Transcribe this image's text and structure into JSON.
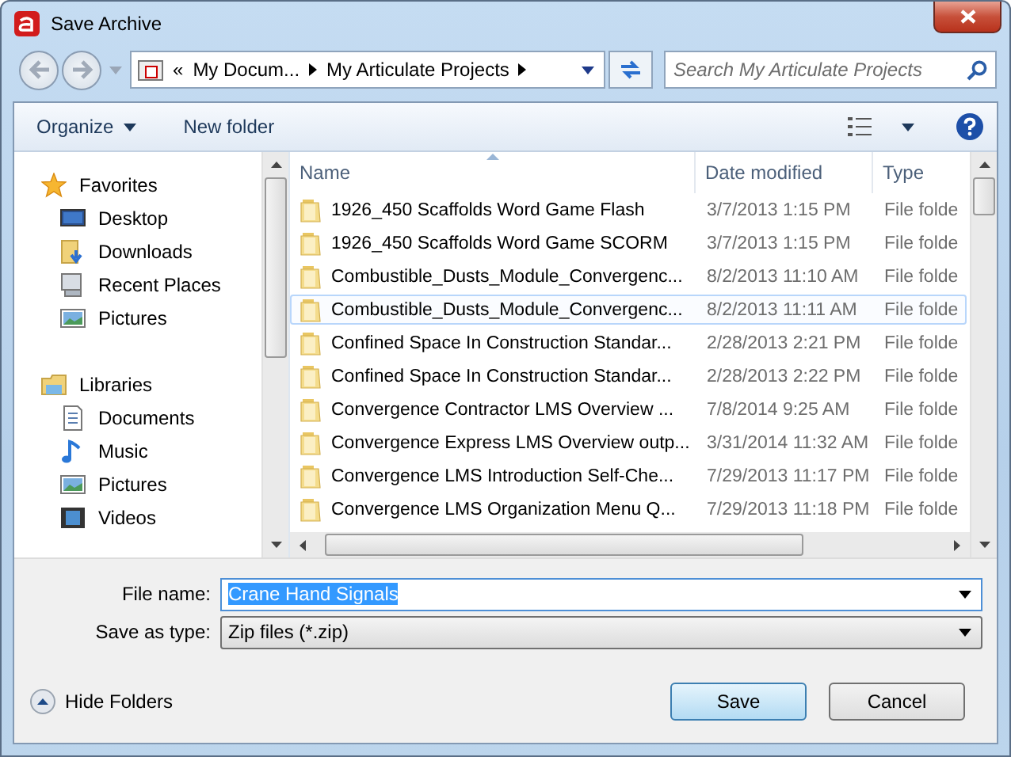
{
  "window": {
    "title": "Save Archive"
  },
  "address": {
    "parts": [
      "«",
      "My Docum...",
      "My Articulate Projects"
    ]
  },
  "search": {
    "placeholder": "Search My Articulate Projects"
  },
  "toolbar": {
    "organize": "Organize",
    "new_folder": "New folder"
  },
  "sidebar": {
    "items": [
      {
        "kind": "group",
        "label": "Favorites"
      },
      {
        "kind": "item",
        "label": "Desktop"
      },
      {
        "kind": "item",
        "label": "Downloads"
      },
      {
        "kind": "item",
        "label": "Recent Places"
      },
      {
        "kind": "item",
        "label": "Pictures"
      },
      {
        "kind": "gap"
      },
      {
        "kind": "group",
        "label": "Libraries"
      },
      {
        "kind": "item",
        "label": "Documents"
      },
      {
        "kind": "item",
        "label": "Music"
      },
      {
        "kind": "item",
        "label": "Pictures"
      },
      {
        "kind": "item",
        "label": "Videos"
      }
    ]
  },
  "table": {
    "columns": [
      "Name",
      "Date modified",
      "Type"
    ],
    "rows": [
      {
        "name": "1926_450 Scaffolds Word Game Flash",
        "date": "3/7/2013 1:15 PM",
        "type": "File folde",
        "selected": false
      },
      {
        "name": "1926_450 Scaffolds Word Game SCORM",
        "date": "3/7/2013 1:15 PM",
        "type": "File folde",
        "selected": false
      },
      {
        "name": "Combustible_Dusts_Module_Convergenc...",
        "date": "8/2/2013 11:10 AM",
        "type": "File folde",
        "selected": false
      },
      {
        "name": "Combustible_Dusts_Module_Convergenc...",
        "date": "8/2/2013 11:11 AM",
        "type": "File folde",
        "selected": true
      },
      {
        "name": "Confined Space In Construction Standar...",
        "date": "2/28/2013 2:21 PM",
        "type": "File folde",
        "selected": false
      },
      {
        "name": "Confined Space In Construction Standar...",
        "date": "2/28/2013 2:22 PM",
        "type": "File folde",
        "selected": false
      },
      {
        "name": "Convergence Contractor LMS Overview ...",
        "date": "7/8/2014 9:25 AM",
        "type": "File folde",
        "selected": false
      },
      {
        "name": "Convergence Express LMS Overview outp...",
        "date": "3/31/2014 11:32 AM",
        "type": "File folde",
        "selected": false
      },
      {
        "name": "Convergence LMS Introduction Self-Che...",
        "date": "7/29/2013 11:17 PM",
        "type": "File folde",
        "selected": false
      },
      {
        "name": "Convergence LMS Organization Menu Q...",
        "date": "7/29/2013 11:18 PM",
        "type": "File folde",
        "selected": false
      }
    ]
  },
  "file_name": {
    "label": "File name:",
    "value": "Crane Hand Signals"
  },
  "save_type": {
    "label": "Save as type:",
    "value": "Zip files (*.zip)"
  },
  "hide_folders": "Hide Folders",
  "buttons": [
    "Save",
    "Cancel"
  ]
}
